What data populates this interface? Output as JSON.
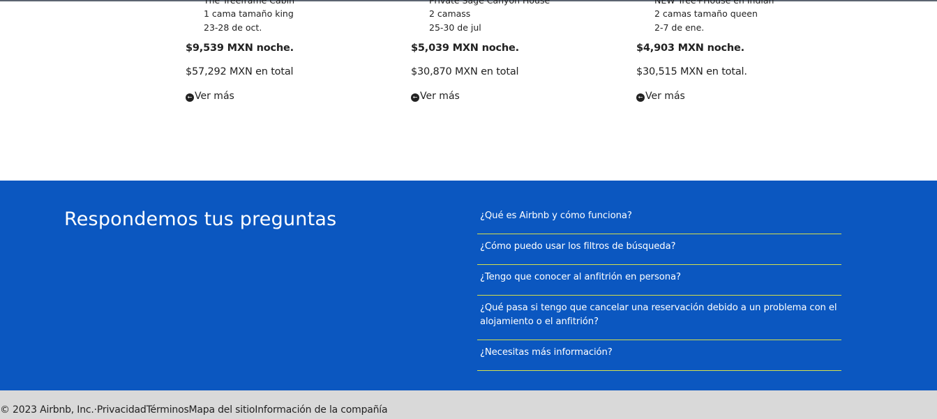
{
  "listings": [
    {
      "name": "The Treeframe Cabin",
      "beds": "1 cama tamaño king",
      "dates": "23-28 de oct.",
      "price_night": "$9,539 MXN noche.",
      "price_total": "$57,292 MXN en total",
      "more": "Ver más"
    },
    {
      "name": "Private Sage Canyon House",
      "beds": "2 camass",
      "dates": "25-30 de jul",
      "price_night": "$5,039 MXN noche.",
      "price_total": "$30,870 MXN en total",
      "more": "Ver más"
    },
    {
      "name": "NEW Tree+House en Indian",
      "beds": "2 camas tamaño queen",
      "dates": "2-7 de ene.",
      "price_night": "$4,903 MXN noche.",
      "price_total": "$30,515 MXN en total.",
      "more": "Ver más"
    }
  ],
  "faq": {
    "title": "Respondemos tus preguntas",
    "questions": [
      "¿Qué es Airbnb y cómo funciona?",
      "¿Cómo puedo usar los filtros de búsqueda?",
      "¿Tengo que conocer al anfitrión en persona?",
      "¿Qué pasa si tengo que cancelar una reservación debido a un problema con el alojamiento o el anfitrión?",
      "¿Necesitas más información?"
    ]
  },
  "footer": {
    "copyright": "© 2023 Airbnb, Inc.",
    "separator": "·",
    "links": [
      "Privacidad",
      "Términos",
      "Mapa del sitio",
      "Información de la compañía"
    ]
  },
  "icons": {
    "more": "arrow-left-circle-icon"
  },
  "colors": {
    "faq_bg": "#0b57c0",
    "divider": "#d6e04a",
    "footer_bg": "#d9d9d9"
  }
}
